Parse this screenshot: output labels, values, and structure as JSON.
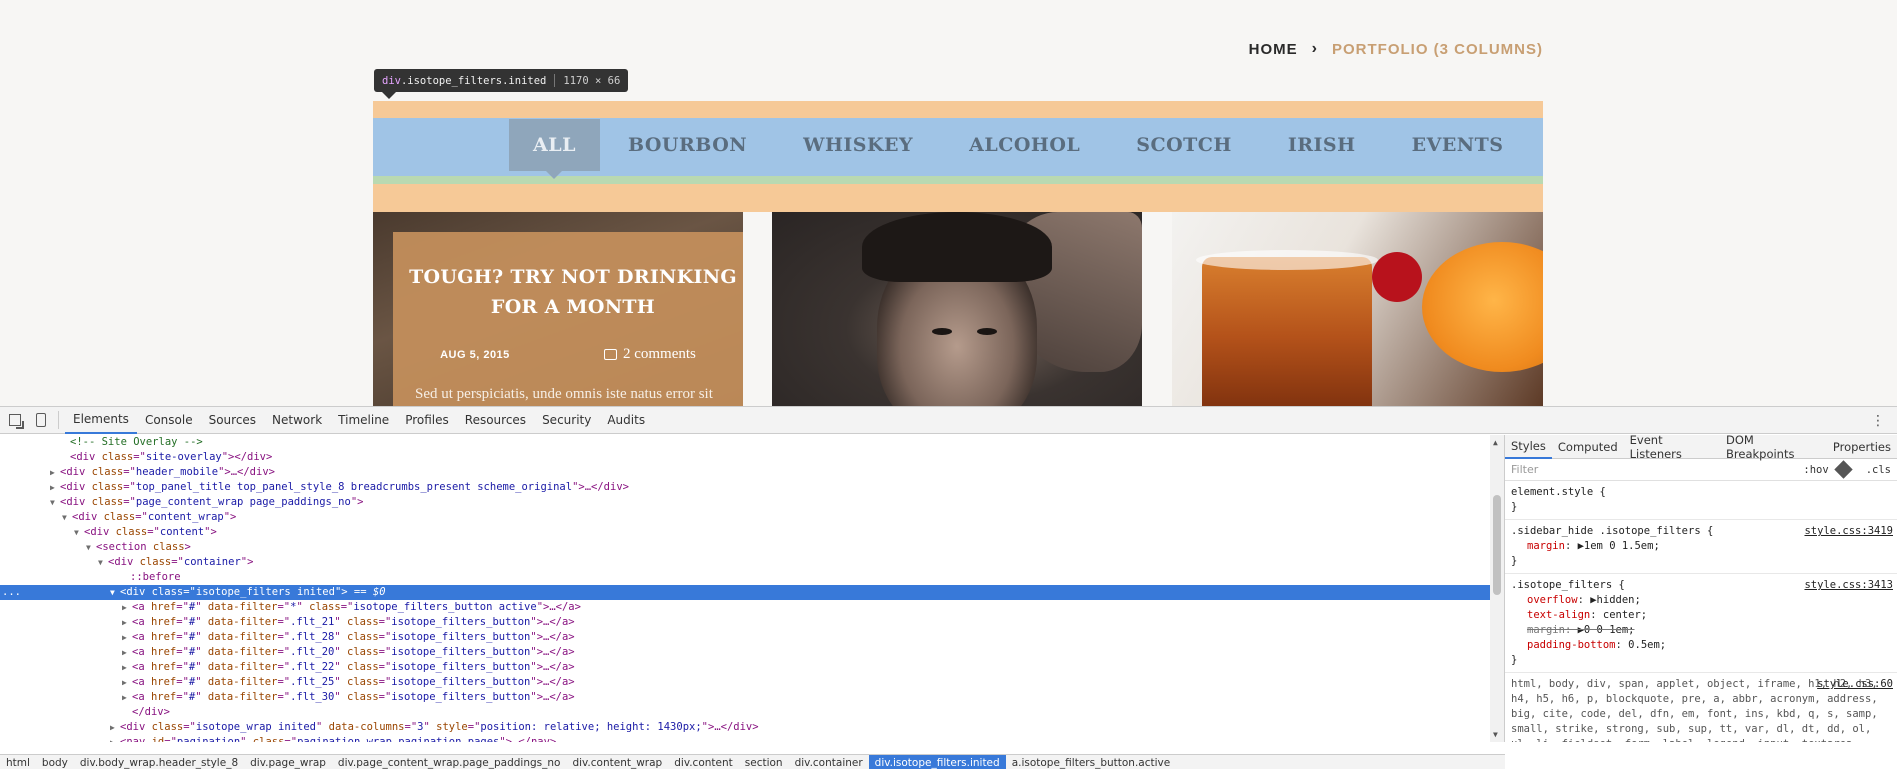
{
  "page": {
    "breadcrumbs": {
      "home": "HOME",
      "separator": "›",
      "current": "PORTFOLIO (3 COLUMNS)"
    },
    "tooltip": {
      "tag": "div",
      "class": ".isotope_filters.inited",
      "size": "1170 × 66"
    },
    "filters": [
      "ALL",
      "BOURBON",
      "WHISKEY",
      "ALCOHOL",
      "SCOTCH",
      "IRISH",
      "EVENTS"
    ],
    "post": {
      "title": "TOUGH? TRY NOT DRINKING FOR A MONTH",
      "date": "AUG 5, 2015",
      "comments": "2 comments",
      "excerpt": "Sed ut perspiciatis, unde omnis iste natus error sit"
    }
  },
  "devtools": {
    "tabs": [
      "Elements",
      "Console",
      "Sources",
      "Network",
      "Timeline",
      "Profiles",
      "Resources",
      "Security",
      "Audits"
    ],
    "dom": [
      {
        "indent": 60,
        "tri": "",
        "html": [
          [
            "comment",
            "<!-- Site Overlay -->"
          ]
        ]
      },
      {
        "indent": 60,
        "tri": "",
        "html": [
          [
            "tag",
            "<div "
          ],
          [
            "a-name",
            "class"
          ],
          [
            "tag",
            "=\""
          ],
          [
            "a-val",
            "site-overlay"
          ],
          [
            "tag",
            "\"></div>"
          ]
        ]
      },
      {
        "indent": 50,
        "tri": "▶",
        "html": [
          [
            "tag",
            "<div "
          ],
          [
            "a-name",
            "class"
          ],
          [
            "tag",
            "=\""
          ],
          [
            "a-val",
            "header_mobile"
          ],
          [
            "tag",
            "\">…</div>"
          ]
        ]
      },
      {
        "indent": 50,
        "tri": "▶",
        "html": [
          [
            "tag",
            "<div "
          ],
          [
            "a-name",
            "class"
          ],
          [
            "tag",
            "=\""
          ],
          [
            "a-val",
            "top_panel_title top_panel_style_8 breadcrumbs_present scheme_original"
          ],
          [
            "tag",
            "\">…</div>"
          ]
        ]
      },
      {
        "indent": 50,
        "tri": "▼",
        "html": [
          [
            "tag",
            "<div "
          ],
          [
            "a-name",
            "class"
          ],
          [
            "tag",
            "=\""
          ],
          [
            "a-val",
            "page_content_wrap page_paddings_no"
          ],
          [
            "tag",
            "\">"
          ]
        ]
      },
      {
        "indent": 62,
        "tri": "▼",
        "html": [
          [
            "tag",
            "<div "
          ],
          [
            "a-name",
            "class"
          ],
          [
            "tag",
            "=\""
          ],
          [
            "a-val",
            "content_wrap"
          ],
          [
            "tag",
            "\">"
          ]
        ]
      },
      {
        "indent": 74,
        "tri": "▼",
        "html": [
          [
            "tag",
            "<div "
          ],
          [
            "a-name",
            "class"
          ],
          [
            "tag",
            "=\""
          ],
          [
            "a-val",
            "content"
          ],
          [
            "tag",
            "\">"
          ]
        ]
      },
      {
        "indent": 86,
        "tri": "▼",
        "html": [
          [
            "tag",
            "<section "
          ],
          [
            "a-name",
            "class"
          ],
          [
            "tag",
            ">"
          ]
        ]
      },
      {
        "indent": 98,
        "tri": "▼",
        "html": [
          [
            "tag",
            "<div "
          ],
          [
            "a-name",
            "class"
          ],
          [
            "tag",
            "=\""
          ],
          [
            "a-val",
            "container"
          ],
          [
            "tag",
            "\">"
          ]
        ]
      },
      {
        "indent": 120,
        "tri": "",
        "html": [
          [
            "pseudo",
            "::before"
          ]
        ]
      },
      {
        "indent": 110,
        "tri": "▼",
        "selected": true,
        "html": [
          [
            "tag",
            "<div "
          ],
          [
            "a-name",
            "class"
          ],
          [
            "tag",
            "=\""
          ],
          [
            "a-val",
            "isotope_filters inited"
          ],
          [
            "tag",
            "\">"
          ],
          [
            "eq",
            " == $0"
          ]
        ]
      },
      {
        "indent": 122,
        "tri": "▶",
        "html": [
          [
            "tag",
            "<a "
          ],
          [
            "a-name",
            "href"
          ],
          [
            "tag",
            "=\""
          ],
          [
            "a-val",
            "#"
          ],
          [
            "tag",
            "\" "
          ],
          [
            "a-name",
            "data-filter"
          ],
          [
            "tag",
            "=\""
          ],
          [
            "a-val",
            "*"
          ],
          [
            "tag",
            "\" "
          ],
          [
            "a-name",
            "class"
          ],
          [
            "tag",
            "=\""
          ],
          [
            "a-val",
            "isotope_filters_button active"
          ],
          [
            "tag",
            "\">…</a>"
          ]
        ]
      },
      {
        "indent": 122,
        "tri": "▶",
        "html": [
          [
            "tag",
            "<a "
          ],
          [
            "a-name",
            "href"
          ],
          [
            "tag",
            "=\""
          ],
          [
            "a-val",
            "#"
          ],
          [
            "tag",
            "\" "
          ],
          [
            "a-name",
            "data-filter"
          ],
          [
            "tag",
            "=\""
          ],
          [
            "a-val",
            ".flt_21"
          ],
          [
            "tag",
            "\" "
          ],
          [
            "a-name",
            "class"
          ],
          [
            "tag",
            "=\""
          ],
          [
            "a-val",
            "isotope_filters_button"
          ],
          [
            "tag",
            "\">…</a>"
          ]
        ]
      },
      {
        "indent": 122,
        "tri": "▶",
        "html": [
          [
            "tag",
            "<a "
          ],
          [
            "a-name",
            "href"
          ],
          [
            "tag",
            "=\""
          ],
          [
            "a-val",
            "#"
          ],
          [
            "tag",
            "\" "
          ],
          [
            "a-name",
            "data-filter"
          ],
          [
            "tag",
            "=\""
          ],
          [
            "a-val",
            ".flt_28"
          ],
          [
            "tag",
            "\" "
          ],
          [
            "a-name",
            "class"
          ],
          [
            "tag",
            "=\""
          ],
          [
            "a-val",
            "isotope_filters_button"
          ],
          [
            "tag",
            "\">…</a>"
          ]
        ]
      },
      {
        "indent": 122,
        "tri": "▶",
        "html": [
          [
            "tag",
            "<a "
          ],
          [
            "a-name",
            "href"
          ],
          [
            "tag",
            "=\""
          ],
          [
            "a-val",
            "#"
          ],
          [
            "tag",
            "\" "
          ],
          [
            "a-name",
            "data-filter"
          ],
          [
            "tag",
            "=\""
          ],
          [
            "a-val",
            ".flt_20"
          ],
          [
            "tag",
            "\" "
          ],
          [
            "a-name",
            "class"
          ],
          [
            "tag",
            "=\""
          ],
          [
            "a-val",
            "isotope_filters_button"
          ],
          [
            "tag",
            "\">…</a>"
          ]
        ]
      },
      {
        "indent": 122,
        "tri": "▶",
        "html": [
          [
            "tag",
            "<a "
          ],
          [
            "a-name",
            "href"
          ],
          [
            "tag",
            "=\""
          ],
          [
            "a-val",
            "#"
          ],
          [
            "tag",
            "\" "
          ],
          [
            "a-name",
            "data-filter"
          ],
          [
            "tag",
            "=\""
          ],
          [
            "a-val",
            ".flt_22"
          ],
          [
            "tag",
            "\" "
          ],
          [
            "a-name",
            "class"
          ],
          [
            "tag",
            "=\""
          ],
          [
            "a-val",
            "isotope_filters_button"
          ],
          [
            "tag",
            "\">…</a>"
          ]
        ]
      },
      {
        "indent": 122,
        "tri": "▶",
        "html": [
          [
            "tag",
            "<a "
          ],
          [
            "a-name",
            "href"
          ],
          [
            "tag",
            "=\""
          ],
          [
            "a-val",
            "#"
          ],
          [
            "tag",
            "\" "
          ],
          [
            "a-name",
            "data-filter"
          ],
          [
            "tag",
            "=\""
          ],
          [
            "a-val",
            ".flt_25"
          ],
          [
            "tag",
            "\" "
          ],
          [
            "a-name",
            "class"
          ],
          [
            "tag",
            "=\""
          ],
          [
            "a-val",
            "isotope_filters_button"
          ],
          [
            "tag",
            "\">…</a>"
          ]
        ]
      },
      {
        "indent": 122,
        "tri": "▶",
        "html": [
          [
            "tag",
            "<a "
          ],
          [
            "a-name",
            "href"
          ],
          [
            "tag",
            "=\""
          ],
          [
            "a-val",
            "#"
          ],
          [
            "tag",
            "\" "
          ],
          [
            "a-name",
            "data-filter"
          ],
          [
            "tag",
            "=\""
          ],
          [
            "a-val",
            ".flt_30"
          ],
          [
            "tag",
            "\" "
          ],
          [
            "a-name",
            "class"
          ],
          [
            "tag",
            "=\""
          ],
          [
            "a-val",
            "isotope_filters_button"
          ],
          [
            "tag",
            "\">…</a>"
          ]
        ]
      },
      {
        "indent": 122,
        "tri": "",
        "html": [
          [
            "tag",
            "</div>"
          ]
        ]
      },
      {
        "indent": 110,
        "tri": "▶",
        "html": [
          [
            "tag",
            "<div "
          ],
          [
            "a-name",
            "class"
          ],
          [
            "tag",
            "=\""
          ],
          [
            "a-val",
            "isotope_wrap  inited"
          ],
          [
            "tag",
            "\" "
          ],
          [
            "a-name",
            "data-columns"
          ],
          [
            "tag",
            "=\""
          ],
          [
            "a-val",
            "3"
          ],
          [
            "tag",
            "\" "
          ],
          [
            "a-name",
            "style"
          ],
          [
            "tag",
            "=\""
          ],
          [
            "a-val",
            "position: relative; height: 1430px;"
          ],
          [
            "tag",
            "\">…</div>"
          ]
        ]
      },
      {
        "indent": 110,
        "tri": "▶",
        "html": [
          [
            "tag",
            "<nav "
          ],
          [
            "a-name",
            "id"
          ],
          [
            "tag",
            "=\""
          ],
          [
            "a-val",
            "pagination"
          ],
          [
            "tag",
            "\" "
          ],
          [
            "a-name",
            "class"
          ],
          [
            "tag",
            "=\""
          ],
          [
            "a-val",
            "pagination_wrap pagination_pages"
          ],
          [
            "tag",
            "\">…</nav>"
          ]
        ]
      }
    ],
    "styles": {
      "tabs": [
        "Styles",
        "Computed",
        "Event Listeners",
        "DOM Breakpoints",
        "Properties"
      ],
      "filter_placeholder": "Filter",
      "hov": ":hov",
      "cls": ".cls",
      "rules": [
        {
          "selector": "element.style {",
          "source": "",
          "props": [],
          "close": "}"
        },
        {
          "selector": ".sidebar_hide .isotope_filters {",
          "source": "style.css:3419",
          "props": [
            {
              "name": "margin",
              "value": "▶1em 0 1.5em;",
              "struck": false
            }
          ],
          "close": "}"
        },
        {
          "selector": ".isotope_filters {",
          "source": "style.css:3413",
          "props": [
            {
              "name": "overflow",
              "value": "▶hidden;",
              "struck": false
            },
            {
              "name": "text-align",
              "value": "center;",
              "struck": false
            },
            {
              "name": "margin",
              "value": "▶0 0 1em;",
              "struck": true
            },
            {
              "name": "padding-bottom",
              "value": "0.5em;",
              "struck": false
            }
          ],
          "close": "}"
        }
      ],
      "ua_source": "style.css:60",
      "ua_text": "html, body, div, span, applet, object, iframe, h1, h2, h3, h4, h5, h6, p, blockquote, pre, a, abbr, acronym, address, big, cite, code, del, dfn, em, font, ins, kbd, q, s, samp, small, strike, strong, sub, sup, tt, var, dl, dt, dd, ol, ul, li, fieldset, form, label, legend, input, textarea, button, table, caption, tbody, tfoot, thead, tr, th, td, article, aside, address,"
    },
    "breadcrumbs": [
      "html",
      "body",
      "div.body_wrap.header_style_8",
      "div.page_wrap",
      "div.page_content_wrap.page_paddings_no",
      "div.content_wrap",
      "div.content",
      "section",
      "div.container",
      "div.isotope_filters.inited",
      "a.isotope_filters_button.active"
    ],
    "active_breadcrumb": 9
  }
}
